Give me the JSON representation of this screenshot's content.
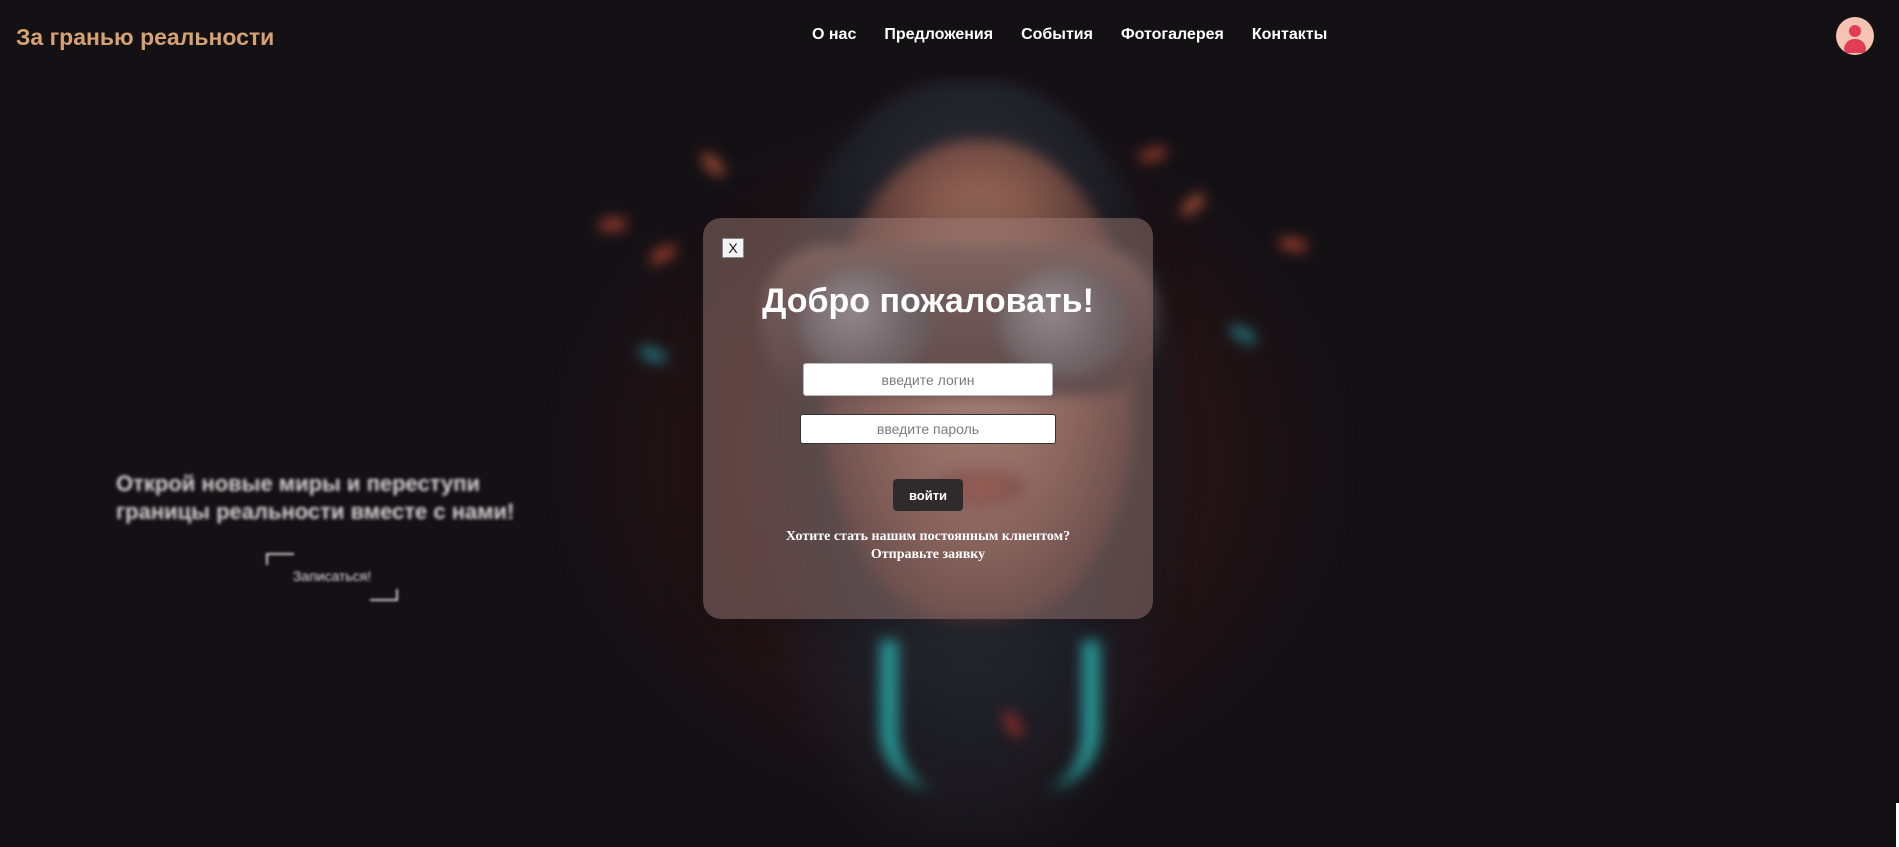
{
  "header": {
    "logo": "За гранью реальности",
    "nav": [
      {
        "label": "О нас"
      },
      {
        "label": "Предложения"
      },
      {
        "label": "События"
      },
      {
        "label": "Фотогалерея"
      },
      {
        "label": "Контакты"
      }
    ],
    "avatar_icon": "user-avatar-icon"
  },
  "hero": {
    "text": "Открой новые миры и переступи границы реальности вместе с нами!",
    "button_label": "Записаться!"
  },
  "modal": {
    "close_label": "X",
    "title": "Добро пожаловать!",
    "login_placeholder": "введите логин",
    "password_placeholder": "введите пароль",
    "submit_label": "войти",
    "note": "Хотите стать нашим постоянным клиентом?",
    "link": "Отправьте заявку"
  },
  "colors": {
    "logo": "#d6a173",
    "background": "#141115",
    "avatar_bg": "#f4c3b3",
    "avatar_fg": "#e23d55",
    "submit_bg": "#2f2b2c",
    "collar_accent": "#2bb6b3"
  }
}
